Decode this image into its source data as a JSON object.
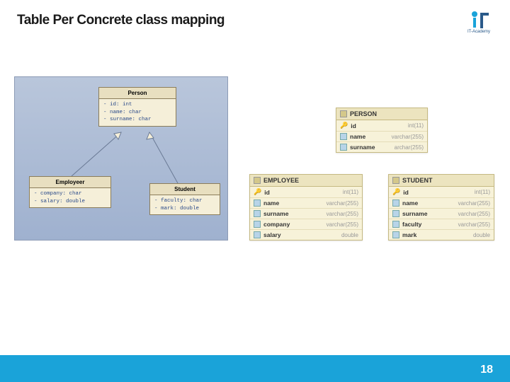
{
  "title": "Table Per Concrete class mapping",
  "logo_text": "IT-Academy",
  "page_number": "18",
  "uml": {
    "person": {
      "name": "Person",
      "attrs": [
        "- id: int",
        "- name: char",
        "- surname: char"
      ]
    },
    "employer": {
      "name": "Employeer",
      "attrs": [
        "- company: char",
        "- salary: double"
      ]
    },
    "student": {
      "name": "Student",
      "attrs": [
        "- faculty: char",
        "- mark: double"
      ]
    }
  },
  "db": {
    "person": {
      "name": "PERSON",
      "cols": [
        {
          "n": "id",
          "t": "int(11)",
          "pk": true
        },
        {
          "n": "name",
          "t": "varchar(255)"
        },
        {
          "n": "surname",
          "t": "archar(255)"
        }
      ]
    },
    "employee": {
      "name": "EMPLOYEE",
      "cols": [
        {
          "n": "id",
          "t": "int(11)",
          "pk": true
        },
        {
          "n": "name",
          "t": "varchar(255)"
        },
        {
          "n": "surname",
          "t": "varchar(255)"
        },
        {
          "n": "company",
          "t": "varchar(255)"
        },
        {
          "n": "salary",
          "t": "double"
        }
      ]
    },
    "student": {
      "name": "STUDENT",
      "cols": [
        {
          "n": "id",
          "t": "int(11)",
          "pk": true
        },
        {
          "n": "name",
          "t": "varchar(255)"
        },
        {
          "n": "surname",
          "t": "varchar(255)"
        },
        {
          "n": "faculty",
          "t": "varchar(255)"
        },
        {
          "n": "mark",
          "t": "double"
        }
      ]
    }
  }
}
